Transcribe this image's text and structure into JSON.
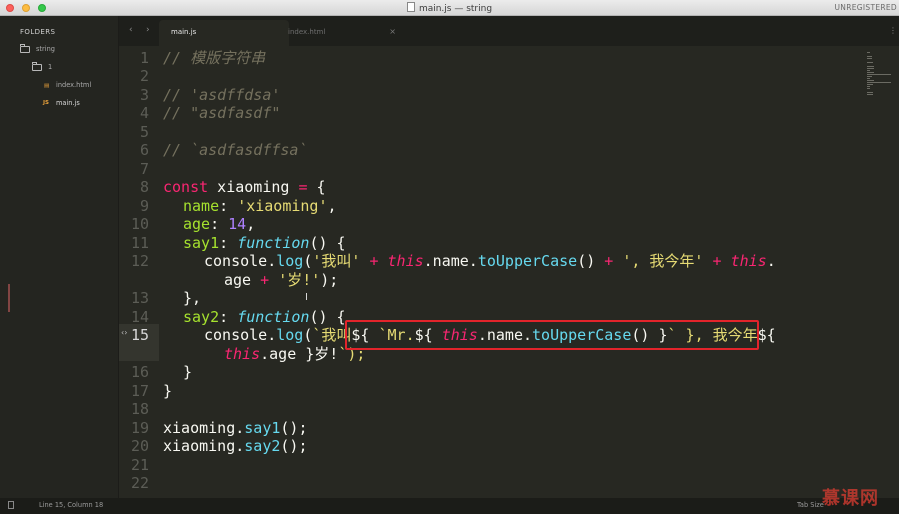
{
  "window": {
    "title": "main.js — string",
    "unregistered": "UNREGISTERED"
  },
  "sidebar": {
    "header": "FOLDERS",
    "tree": [
      {
        "label": "string",
        "type": "folder"
      },
      {
        "label": "1",
        "type": "folder"
      },
      {
        "label": "index.html",
        "type": "file",
        "icon": "html-file-icon"
      },
      {
        "label": "main.js",
        "type": "file",
        "icon_text": "JS"
      }
    ]
  },
  "tabs": [
    {
      "label": "main.js",
      "active": true
    },
    {
      "label": "index.html",
      "active": false
    }
  ],
  "editor": {
    "current_line": 15,
    "line_numbers": [
      "1",
      "2",
      "3",
      "4",
      "5",
      "6",
      "7",
      "8",
      "9",
      "10",
      "11",
      "12",
      "",
      "13",
      "14",
      "15",
      "",
      "16",
      "17",
      "18",
      "19",
      "20",
      "21",
      "22"
    ],
    "code": [
      "// 模版字符串",
      "",
      "// 'asdffdsa'",
      "// \"asdfasdf\"",
      "",
      "// `asdfasdffsa`",
      "",
      "const xiaoming = {",
      "name: 'xiaoming',",
      "age: 14,",
      "say1: function() {",
      "console.log('我叫' + this.name.toUpperCase() + ', 我今年' + this.",
      "age + '岁!');",
      "},",
      "say2: function() {",
      "console.log(`我叫${ `Mr.${ this.name.toUpperCase() }` }, 我今年${",
      "this.age }岁!`);",
      "}",
      "}",
      "",
      "xiaoming.say1();",
      "xiaoming.say2();",
      "",
      ""
    ]
  },
  "statusbar": {
    "position": "Line 15, Column 18",
    "tab_size": "Tab Size"
  },
  "watermark": "慕课网",
  "colors": {
    "background": "#272822",
    "comment": "#75715e",
    "keyword": "#f92672",
    "string": "#e6db74",
    "number": "#ae81ff",
    "function": "#a6e22e",
    "highlight_box": "#e3242b"
  }
}
